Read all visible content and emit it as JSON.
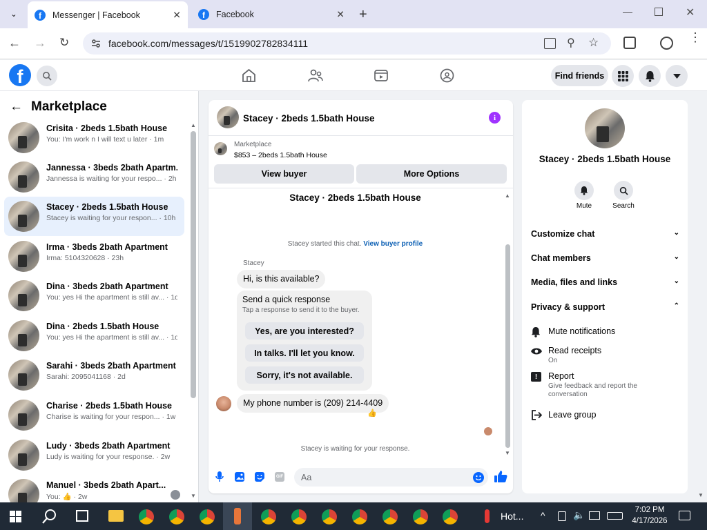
{
  "browser": {
    "tabs": [
      {
        "title": "Messenger | Facebook",
        "active": true
      },
      {
        "title": "Facebook",
        "active": false
      }
    ],
    "url": "facebook.com/messages/t/1519902782834111"
  },
  "fb_header": {
    "find_friends_label": "Find friends"
  },
  "left_panel": {
    "title": "Marketplace",
    "conversations": [
      {
        "name": "Crisita · 2beds 1.5bath House",
        "preview": "You: I'm work n I will text u later · 1m"
      },
      {
        "name": "Jannessa · 3beds 2bath Apartm...",
        "preview": "Jannessa is waiting for your respo... · 2h"
      },
      {
        "name": "Stacey · 2beds 1.5bath House",
        "preview": "Stacey is waiting for your respon... · 10h",
        "selected": true
      },
      {
        "name": "Irma · 3beds 2bath Apartment",
        "preview": "Irma: 5104320628 · 23h"
      },
      {
        "name": "Dina · 3beds 2bath Apartment",
        "preview": "You: yes Hi the apartment is still av... · 1d"
      },
      {
        "name": "Dina · 2beds 1.5bath House",
        "preview": "You: yes Hi the apartment is still av... · 1d"
      },
      {
        "name": "Sarahi · 3beds 2bath Apartment",
        "preview": "Sarahi: 2095041168 · 2d"
      },
      {
        "name": "Charise · 2beds 1.5bath House",
        "preview": "Charise is waiting for your respon... · 1w"
      },
      {
        "name": "Ludy · 3beds 2bath Apartment",
        "preview": "Ludy is waiting for your response. · 2w"
      },
      {
        "name": "Manuel · 3beds 2bath Apart...",
        "preview": "You: 👍 · 2w"
      }
    ]
  },
  "chat": {
    "header_title": "Stacey · 2beds 1.5bath House",
    "listing_source": "Marketplace",
    "listing_price_title": "$853 – 2beds 1.5bath House",
    "view_buyer_label": "View buyer",
    "more_options_label": "More Options",
    "thread_title": "Stacey · 2beds 1.5bath House",
    "started_text": "Stacey started this chat.",
    "view_profile_link": "View buyer profile",
    "sender_name": "Stacey",
    "msg_available": "Hi, is this available?",
    "quick_response_title": "Send a quick response",
    "quick_response_sub": "Tap a response to send it to the buyer.",
    "quick_replies": [
      "Yes, are you interested?",
      "In talks. I'll let you know.",
      "Sorry, it's not available."
    ],
    "msg_phone": "My phone number is (209) 214-4409",
    "reaction": "👍",
    "waiting_text": "Stacey is waiting for your response.",
    "composer_placeholder": "Aa"
  },
  "right_panel": {
    "name": "Stacey · 2beds 1.5bath House",
    "mute_label": "Mute",
    "search_label": "Search",
    "sections": [
      "Customize chat",
      "Chat members",
      "Media, files and links",
      "Privacy & support"
    ],
    "privacy_items": [
      {
        "title": "Mute notifications",
        "sub": ""
      },
      {
        "title": "Read receipts",
        "sub": "On"
      },
      {
        "title": "Report",
        "sub": "Give feedback and report the conversation"
      },
      {
        "title": "Leave group",
        "sub": ""
      }
    ]
  },
  "taskbar": {
    "weather_label": "Hot...",
    "time": "7:02 PM",
    "date": "4/17/2026"
  },
  "colors": {
    "fb_blue": "#1877f2",
    "messenger_purple": "#a033ff",
    "selected_bg": "#e7f0fd"
  }
}
